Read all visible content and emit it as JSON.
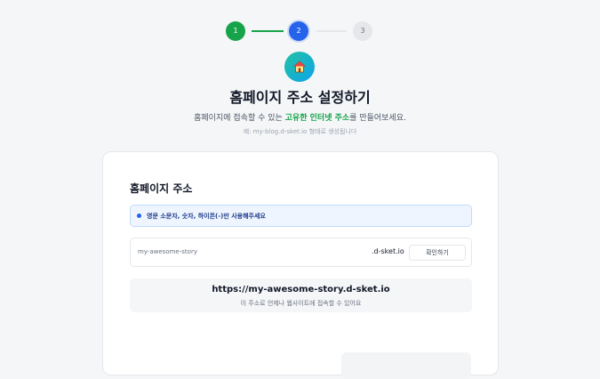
{
  "stepper": {
    "steps": [
      {
        "label": "1",
        "state": "done"
      },
      {
        "label": "2",
        "state": "active"
      },
      {
        "label": "3",
        "state": "upcoming"
      }
    ]
  },
  "header": {
    "icon": "house-icon",
    "title": "홈페이지 주소 설정하기",
    "subtitle_prefix": "홈페이지에 접속할 수 있는 ",
    "subtitle_highlight": "고유한 인터넷 주소",
    "subtitle_suffix": "를 만들어보세요.",
    "example": "예: my-blog.d-sket.io 형태로 생성됩니다"
  },
  "card": {
    "title": "홈페이지 주소",
    "info_text": "영문 소문자, 숫자, 하이픈(-)만 사용해주세요",
    "address_input": {
      "value": "my-awesome-story",
      "placeholder": "my-awesome-story"
    },
    "domain_suffix": ".d-sket.io",
    "check_button_label": "확인하기",
    "preview_url": "https://my-awesome-story.d-sket.io",
    "preview_note": "이 주소로 언제나 웹사이트에 접속할 수 있어요"
  },
  "colors": {
    "done": "#16a34a",
    "active": "#2563eb",
    "upcoming": "#e5e7eb",
    "highlight": "#16a34a",
    "info_bg": "#eef5fe"
  }
}
